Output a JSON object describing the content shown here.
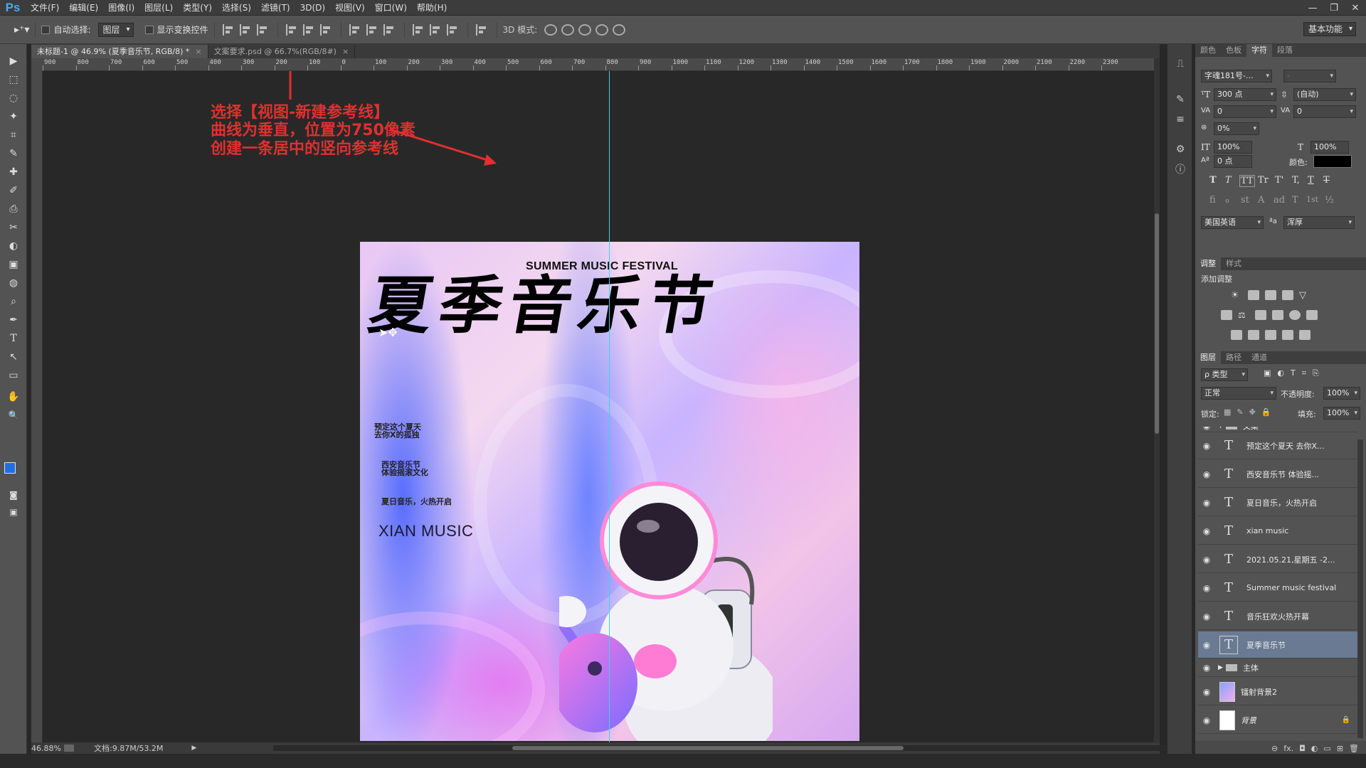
{
  "app": {
    "logo": "Ps"
  },
  "menu": [
    "文件(F)",
    "编辑(E)",
    "图像(I)",
    "图层(L)",
    "类型(Y)",
    "选择(S)",
    "滤镜(T)",
    "3D(D)",
    "视图(V)",
    "窗口(W)",
    "帮助(H)"
  ],
  "window_controls": [
    "—",
    "❐",
    "✕"
  ],
  "options": {
    "auto_select_label": "自动选择:",
    "auto_select_value": "图层",
    "show_transform_label": "显示变换控件",
    "mode3d_label": "3D 模式:",
    "workspace": "基本功能"
  },
  "tabs": [
    {
      "label": "未标题-1 @ 46.9% (夏季音乐节, RGB/8) *",
      "close": "×"
    },
    {
      "label": "文案要求.psd @ 66.7%(RGB/8#)",
      "close": "×"
    }
  ],
  "ruler_labels": [
    "900",
    "800",
    "700",
    "600",
    "500",
    "400",
    "300",
    "200",
    "100",
    "0",
    "100",
    "200",
    "300",
    "400",
    "500",
    "600",
    "700",
    "800",
    "900",
    "1000",
    "1100",
    "1200",
    "1300",
    "1400",
    "1500",
    "1600",
    "1700",
    "1800",
    "1900",
    "2000",
    "2100",
    "2200",
    "2300"
  ],
  "tools": [
    "▶",
    "⬚",
    "◌",
    "✦",
    "⌗",
    "✎",
    "✚",
    "✐",
    "⎙",
    "✂",
    "◐",
    "▣",
    "◍",
    "⌕",
    "✒",
    "T",
    "↖",
    "▭",
    "✋",
    "🔍"
  ],
  "annotation": {
    "lines": [
      "选择【视图-新建参考线】",
      "曲线为垂直，位置为750像素",
      "创建一条居中的竖向参考线"
    ],
    "color": "#e03030"
  },
  "poster": {
    "subtitle": "SUMMER MUSIC FESTIVAL",
    "title": "夏季音乐节",
    "line1a": "预定这个夏天",
    "line1b": "去你X的孤独",
    "line2a": "西安音乐节",
    "line2b": "体验摇滚文化",
    "line3": "夏日音乐，火热开启",
    "brand": "XIAN MUSIC"
  },
  "status": {
    "zoom": "46.88%",
    "doc": "文档:9.87M/53.2M"
  },
  "panel_tabs_top": [
    "颜色",
    "色板",
    "字符",
    "段落"
  ],
  "character": {
    "font_family": "字魂181号-...",
    "font_style": "-",
    "font_size": "300 点",
    "leading": "(自动)",
    "kerning": "0",
    "tracking": "0",
    "tsume": "0%",
    "vscale": "100%",
    "hscale": "100%",
    "baseline": "0 点",
    "color_label": "颜色:",
    "color": "#000000",
    "language": "美国英语",
    "aa_label": "ªa",
    "antialias": "浑厚",
    "type_buttons": [
      "T",
      "T",
      "TT",
      "Tr",
      "T'",
      "T,",
      "T",
      "T"
    ],
    "ot_buttons": [
      "fi",
      "ℴ",
      "st",
      "A",
      "ad",
      "T",
      "1st",
      "½"
    ]
  },
  "adjust_tabs": [
    "调整",
    "样式"
  ],
  "adjust_title": "添加调整",
  "layers_tabs": [
    "图层",
    "路径",
    "通道"
  ],
  "layers_filter": "ρ 类型",
  "blend_mode": "正常",
  "opacity_label": "不透明度:",
  "opacity": "100%",
  "lock_label": "锁定:",
  "fill_label": "填充:",
  "fill": "100%",
  "group_label": "文案",
  "layers": [
    {
      "name": "预定这个夏天 去你X...",
      "kind": "T"
    },
    {
      "name": "西安音乐节 体验摇...",
      "kind": "T"
    },
    {
      "name": "夏日音乐，火热开启",
      "kind": "T"
    },
    {
      "name": "xian music",
      "kind": "T"
    },
    {
      "name": "2021.05.21,星期五 -2...",
      "kind": "T"
    },
    {
      "name": "Summer music festival",
      "kind": "T"
    },
    {
      "name": "音乐狂欢火热开幕",
      "kind": "T"
    },
    {
      "name": "夏季音乐节",
      "kind": "T",
      "selected": true
    }
  ],
  "layer_group_main": "主体",
  "layer_bg2": "镭射背景2",
  "layer_bg": "背景",
  "layer_bottom_icons": [
    "⊖",
    "fx.",
    "◘",
    "◐",
    "▭",
    "⊞",
    "🗑"
  ]
}
